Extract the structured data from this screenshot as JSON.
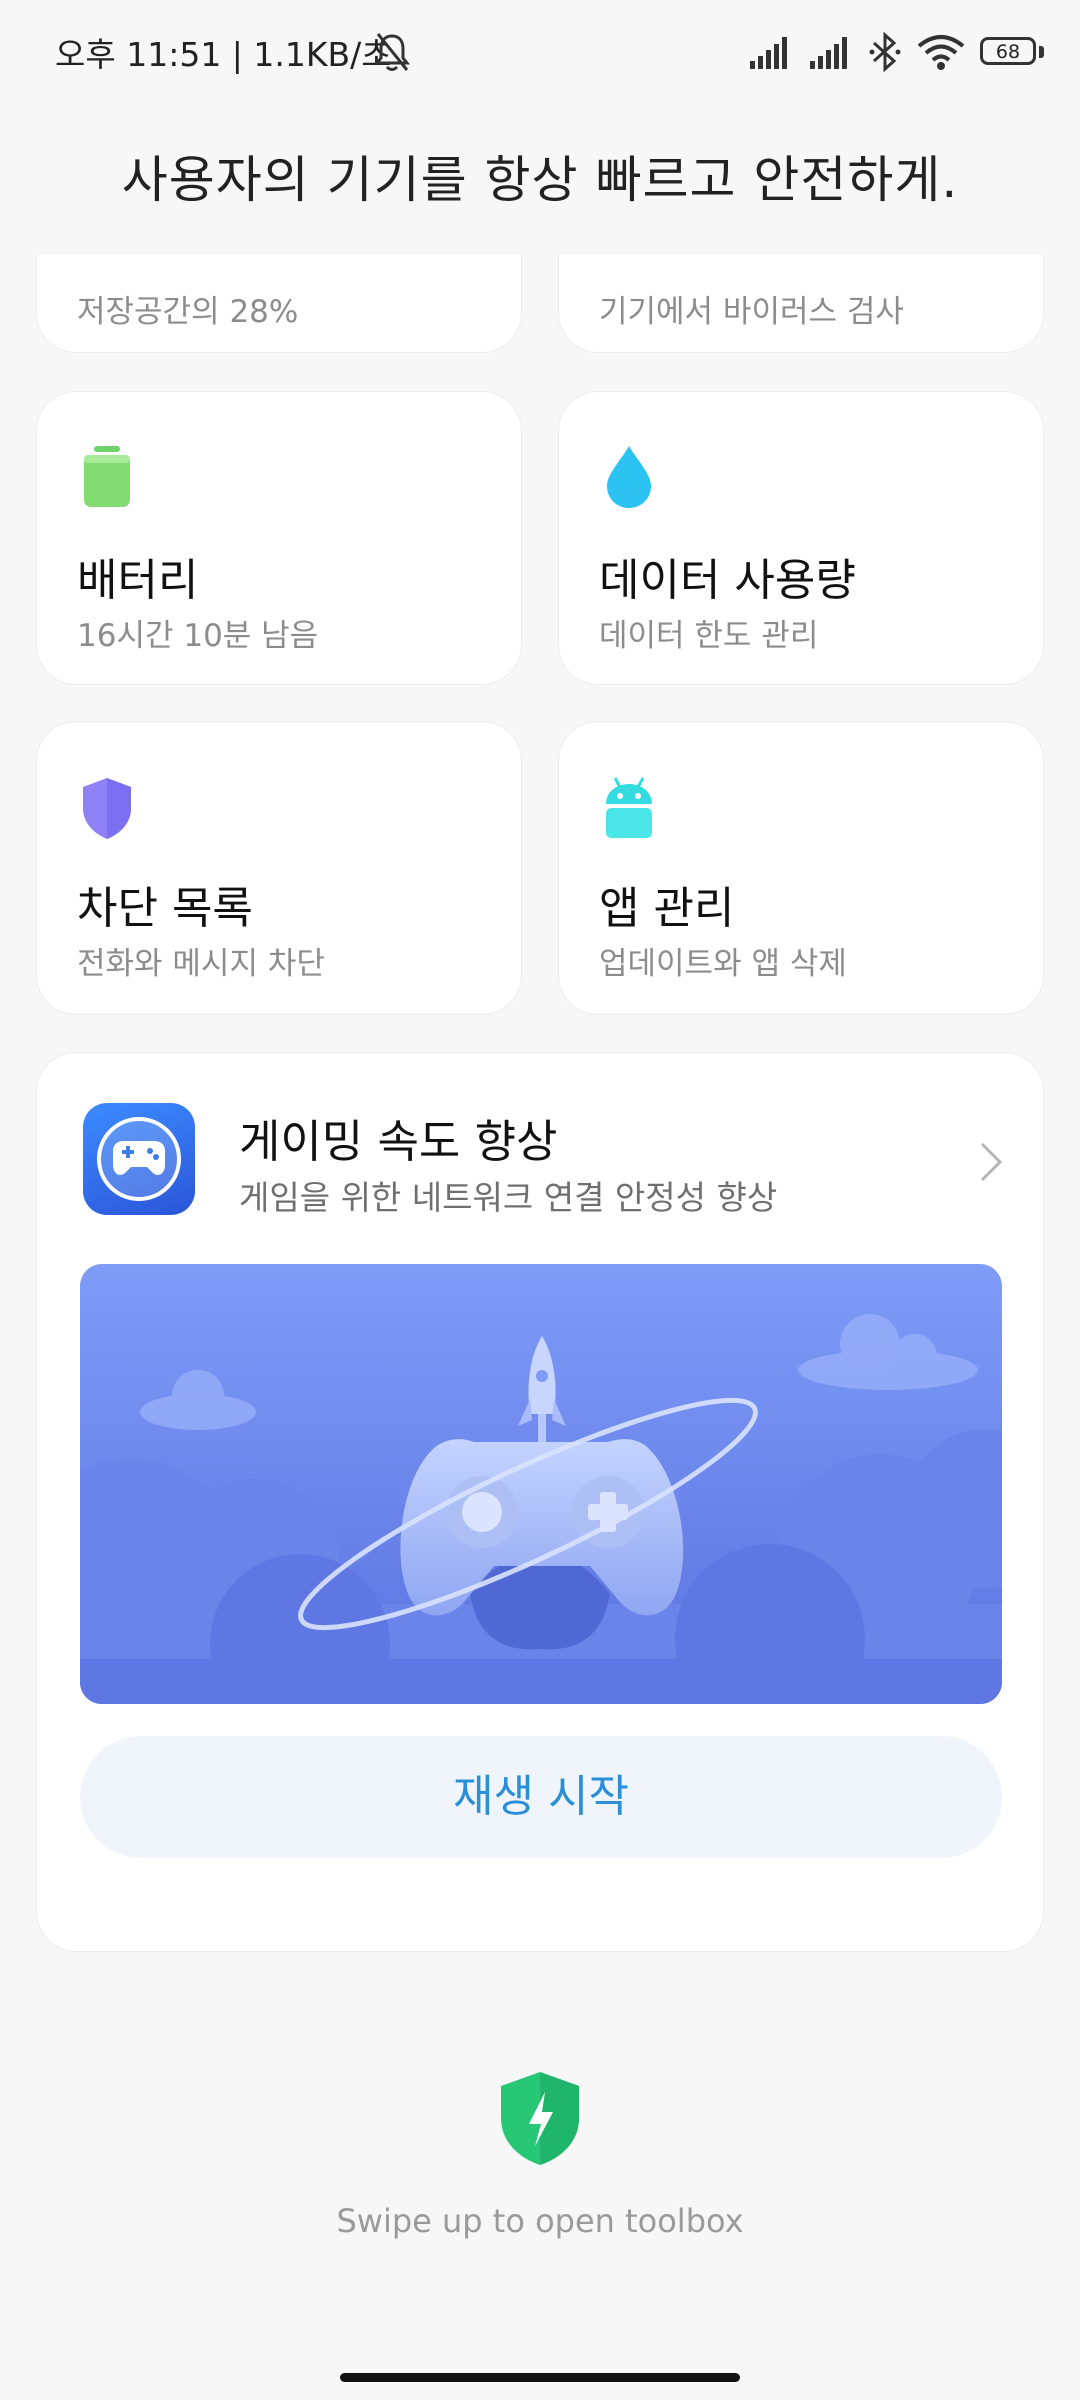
{
  "status_bar": {
    "time_and_speed": "오후 11:51 | 1.1KB/초",
    "battery": "68",
    "icons": [
      "bell-off-icon",
      "signal-icon",
      "signal-icon",
      "bluetooth-icon",
      "wifi-icon",
      "battery-icon"
    ]
  },
  "headline": "사용자의 기기를 항상 빠르고 안전하게.",
  "cards": [
    {
      "title": "",
      "subtitle": "저장공간의 28%"
    },
    {
      "title": "",
      "subtitle": "기기에서 바이러스 검사"
    },
    {
      "title": "배터리",
      "subtitle": "16시간 10분  남음",
      "icon": "battery-icon",
      "color": "#6fd16b"
    },
    {
      "title": "데이터 사용량",
      "subtitle": "데이터 한도 관리",
      "icon": "water-drop-icon",
      "color": "#26c2f2"
    },
    {
      "title": "차단 목록",
      "subtitle": "전화와 메시지 차단",
      "icon": "shield-icon",
      "color": "#8a7cf2"
    },
    {
      "title": "앱 관리",
      "subtitle": "업데이트와 앱 삭제",
      "icon": "android-icon",
      "color": "#34dbe0"
    }
  ],
  "game_booster": {
    "title": "게이밍 속도 향상",
    "subtitle": "게임을 위한 네트워크 연결 안정성 향상",
    "button": "재생 시작",
    "icon": "gamepad-icon"
  },
  "toolbox_hint": "Swipe up to open toolbox",
  "colors": {
    "accent": "#2a8fd6",
    "banner_top": "#7f9cf7",
    "banner_bottom": "#5a72e0",
    "toolbox_green": "#27c776"
  }
}
